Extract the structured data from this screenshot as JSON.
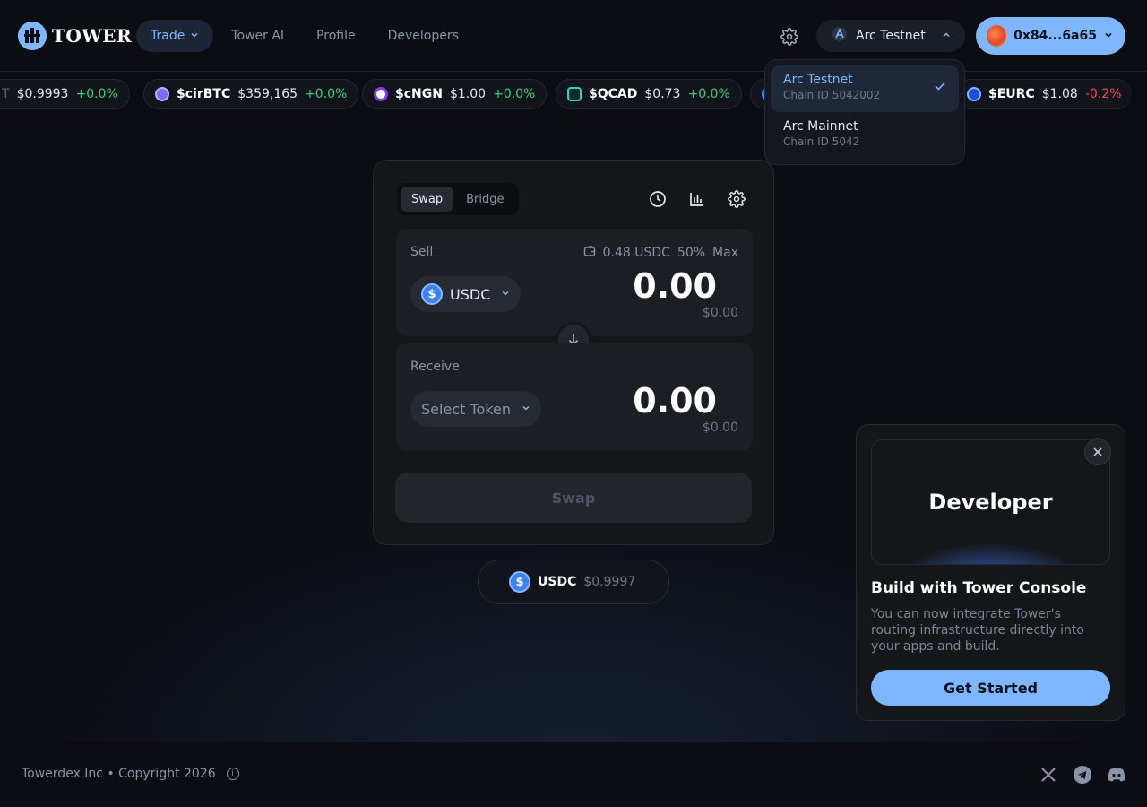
{
  "header": {
    "brand": "TOWER",
    "nav": [
      {
        "label": "Trade",
        "active": true
      },
      {
        "label": "Tower AI"
      },
      {
        "label": "Profile"
      },
      {
        "label": "Developers"
      }
    ],
    "network_label": "Arc Testnet",
    "wallet_label": "0x84...6a65"
  },
  "network_dropdown": {
    "items": [
      {
        "title": "Arc Testnet",
        "sub": "Chain ID 5042002",
        "selected": true
      },
      {
        "title": "Arc Mainnet",
        "sub": "Chain ID 5042"
      }
    ]
  },
  "ticker": [
    {
      "sym": "T",
      "price": "$0.9993",
      "chg": "+0.0%"
    },
    {
      "sym": "$cirBTC",
      "price": "$359,165",
      "chg": "+0.0%"
    },
    {
      "sym": "$cNGN",
      "price": "$1.00",
      "chg": "+0.0%"
    },
    {
      "sym": "$QCAD",
      "price": "$0.73",
      "chg": "+0.0%"
    },
    {
      "sym": "$EURC",
      "price": "$1.08",
      "chg": "-0.2%"
    }
  ],
  "swap": {
    "tabs": [
      "Swap",
      "Bridge"
    ],
    "sell_label": "Sell",
    "balance": "0.48 USDC",
    "pct_50": "50%",
    "max": "Max",
    "sell_token": "USDC",
    "sell_amount": "0.00",
    "sell_usd": "$0.00",
    "receive_label": "Receive",
    "receive_token_placeholder": "Select Token",
    "receive_amount": "0.00",
    "receive_usd": "$0.00",
    "submit_label": "Swap"
  },
  "price_pill": {
    "token": "USDC",
    "price": "$0.9997"
  },
  "promo": {
    "hero": "Developer",
    "title": "Build with Tower Console",
    "desc": "You can now integrate Tower's routing infrastructure directly into your apps and build.",
    "cta": "Get Started"
  },
  "footer": {
    "copyright": "Towerdex Inc • Copyright 2026"
  },
  "colors": {
    "accent": "#7eb7ff",
    "positive": "#34d27b",
    "negative": "#ef4d55",
    "bg": "#0b0d12"
  }
}
